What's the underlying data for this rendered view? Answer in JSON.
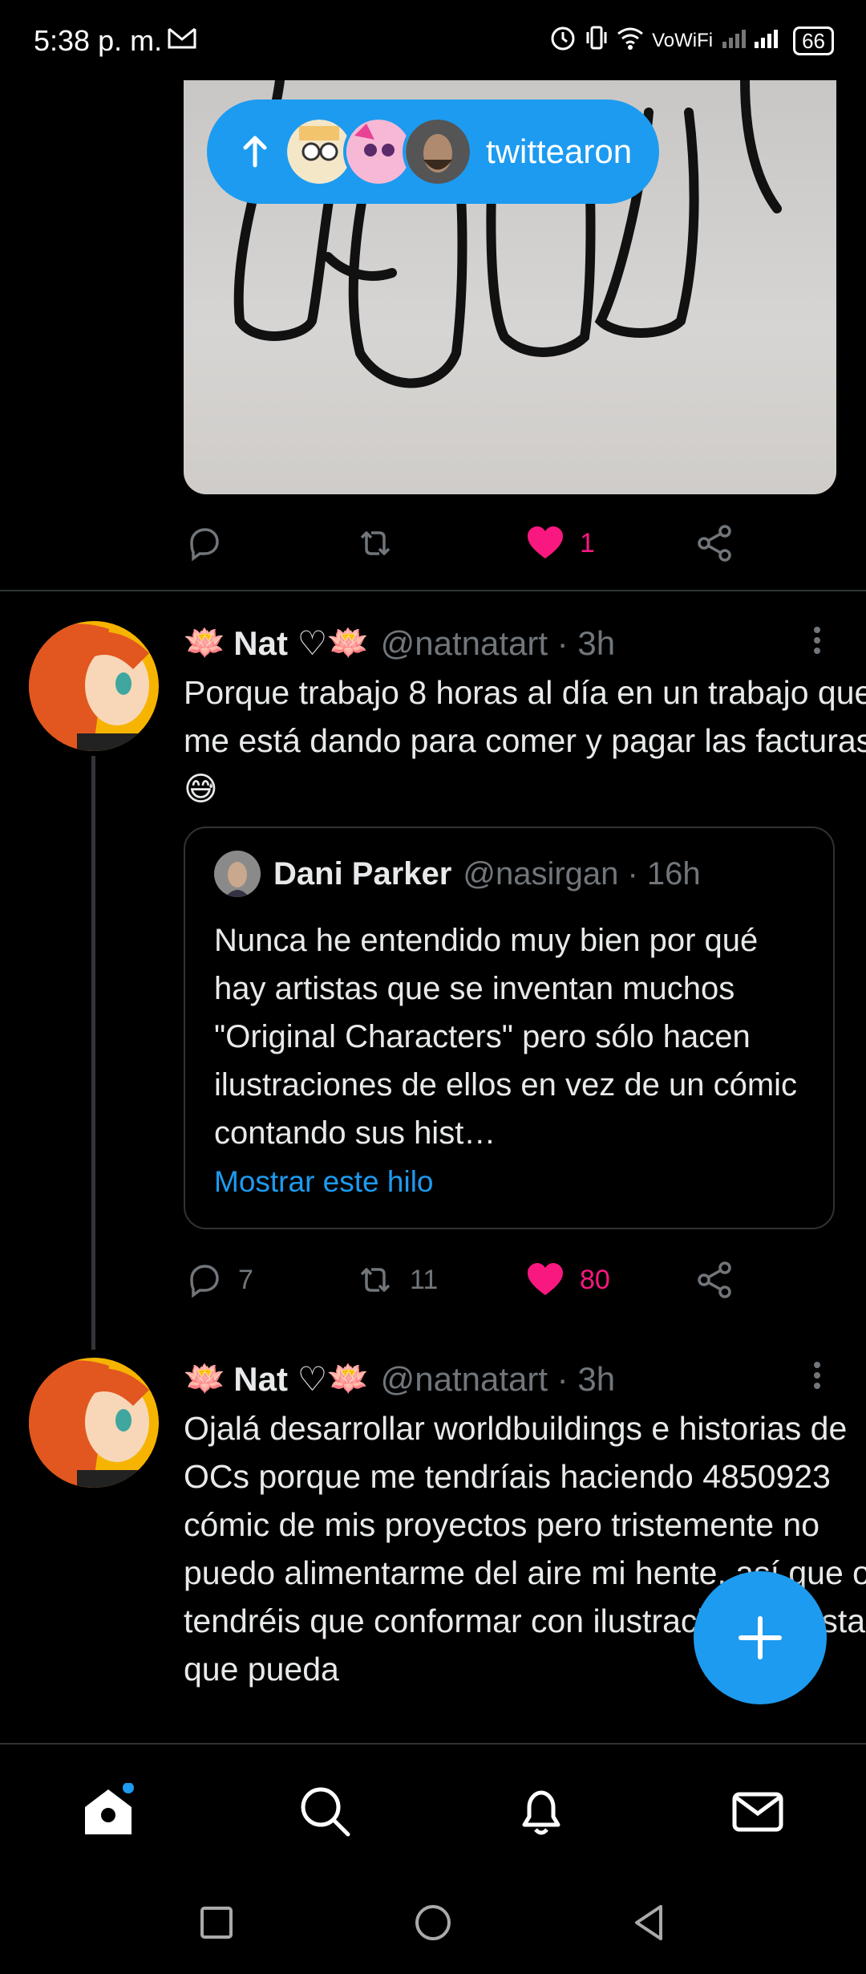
{
  "status_bar": {
    "time": "5:38 p. m.",
    "network": "VoWiFi",
    "battery": "66"
  },
  "toast": {
    "label": "twittearon"
  },
  "first_tweet_actions": {
    "likes": "1"
  },
  "tweet1": {
    "name": "Nat ♡",
    "handle": "@natnatart · 3h",
    "text": "Porque trabajo 8 horas al día en un trabajo que me está dando para comer y pagar las facturas 😅",
    "quote": {
      "name": "Dani Parker",
      "handle": "@nasirgan · 16h",
      "text": "Nunca he entendido muy bien por qué hay artistas que se inventan muchos \"Original Characters\" pero sólo hacen ilustraciones de ellos en vez de un cómic contando sus hist…",
      "link": "Mostrar este hilo"
    },
    "replies": "7",
    "retweets": "11",
    "likes": "80"
  },
  "tweet2": {
    "name": "Nat ♡",
    "handle": "@natnatart · 3h",
    "text": "Ojalá desarrollar worldbuildings e historias de OCs porque me tendríais haciendo 4850923 cómic de mis proyectos pero tristemente no puedo alimentarme del aire mi hente, así que os tendréis que conformar con ilustraciones hasta que pueda"
  },
  "colors": {
    "accent": "#1d9bf0",
    "like": "#f91880",
    "muted": "#71767b"
  }
}
